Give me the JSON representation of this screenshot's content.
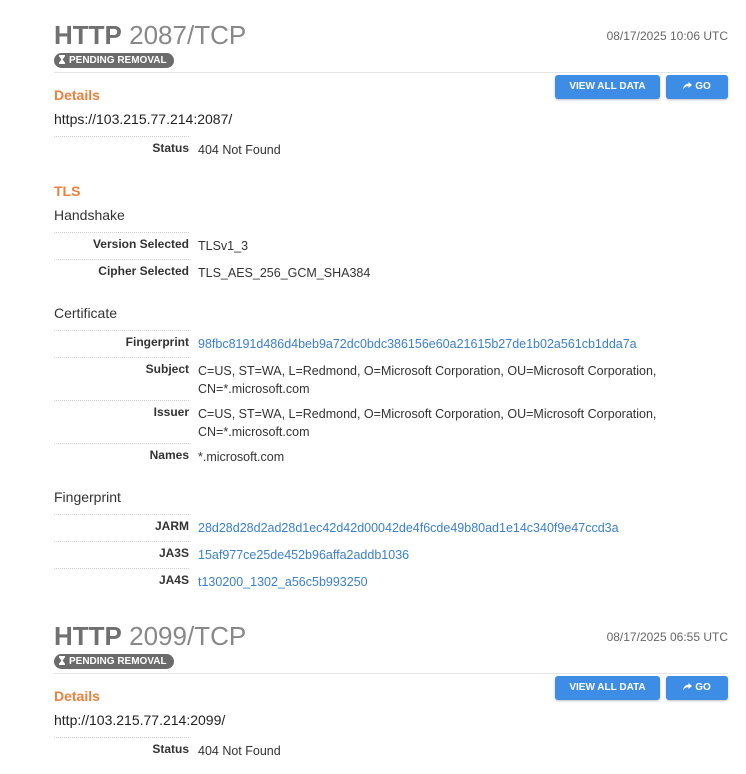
{
  "services": [
    {
      "protocol": "HTTP",
      "port": "2087/TCP",
      "date": "08/17/2025 10:06 UTC",
      "badge": "PENDING REMOVAL",
      "buttons": {
        "view_all": "VIEW ALL DATA",
        "go": "GO"
      },
      "details": {
        "heading": "Details",
        "url": "https://103.215.77.214:2087/",
        "status_label": "Status",
        "status_value": "404  Not Found"
      },
      "tls": {
        "heading": "TLS",
        "handshake_heading": "Handshake",
        "handshake": [
          {
            "label": "Version Selected",
            "value": "TLSv1_3"
          },
          {
            "label": "Cipher Selected",
            "value": "TLS_AES_256_GCM_SHA384"
          }
        ],
        "certificate_heading": "Certificate",
        "certificate": [
          {
            "label": "Fingerprint",
            "value": "98fbc8191d486d4beb9a72dc0bdc386156e60a21615b27de1b02a561cb1dda7a"
          },
          {
            "label": "Subject",
            "value": "C=US, ST=WA, L=Redmond, O=Microsoft Corporation, OU=Microsoft Corporation, CN=*.microsoft.com"
          },
          {
            "label": "Issuer",
            "value": "C=US, ST=WA, L=Redmond, O=Microsoft Corporation, OU=Microsoft Corporation, CN=*.microsoft.com"
          },
          {
            "label": "Names",
            "value": "*.microsoft.com"
          }
        ],
        "fingerprint_heading": "Fingerprint",
        "fingerprint": [
          {
            "label": "JARM",
            "value": "28d28d28d2ad28d1ec42d42d00042de4f6cde49b80ad1e14c340f9e47ccd3a"
          },
          {
            "label": "JA3S",
            "value": "15af977ce25de452b96affa2addb1036"
          },
          {
            "label": "JA4S",
            "value": "t130200_1302_a56c5b993250"
          }
        ]
      }
    },
    {
      "protocol": "HTTP",
      "port": "2099/TCP",
      "date": "08/17/2025 06:55 UTC",
      "badge": "PENDING REMOVAL",
      "buttons": {
        "view_all": "VIEW ALL DATA",
        "go": "GO"
      },
      "details": {
        "heading": "Details",
        "url": "http://103.215.77.214:2099/",
        "status_label": "Status",
        "status_value": "404  Not Found"
      }
    }
  ],
  "colors": {
    "accent": "#ef7f3a",
    "button": "#3d8ce6",
    "link": "#3a7fd0",
    "badge": "#6b6b6b"
  }
}
